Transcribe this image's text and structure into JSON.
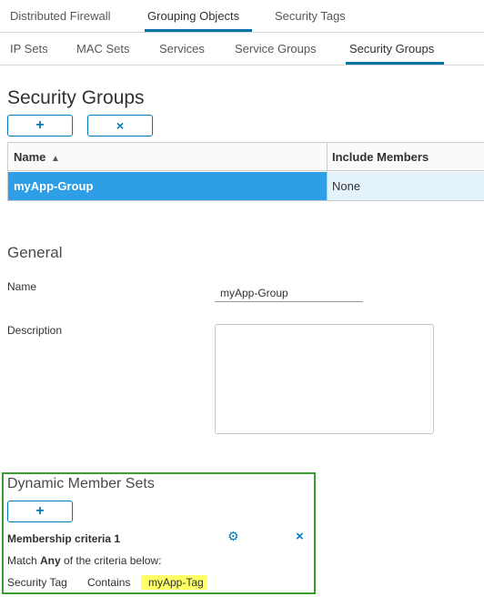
{
  "tabs_primary": [
    {
      "label": "Distributed Firewall"
    },
    {
      "label": "Grouping Objects",
      "active": true
    },
    {
      "label": "Security Tags"
    }
  ],
  "tabs_secondary": [
    {
      "label": "IP Sets"
    },
    {
      "label": "MAC Sets"
    },
    {
      "label": "Services"
    },
    {
      "label": "Service Groups"
    },
    {
      "label": "Security Groups",
      "active": true
    }
  ],
  "page_title": "Security Groups",
  "toolbar": {
    "add_label": "+",
    "delete_label": "×"
  },
  "grid": {
    "columns": [
      "Name",
      "Include Members"
    ],
    "sort_indicator": "▲",
    "rows": [
      {
        "name": "myApp-Group",
        "include_members": "None"
      }
    ]
  },
  "general": {
    "title": "General",
    "name_label": "Name",
    "name_value": "myApp-Group",
    "description_label": "Description",
    "description_value": ""
  },
  "dynamic_member_sets": {
    "title": "Dynamic Member Sets",
    "add_label": "+",
    "criteria_title": "Membership criteria 1",
    "match_prefix": "Match ",
    "match_value": "Any",
    "match_suffix": " of the criteria below:",
    "criterion": {
      "field": "Security Tag",
      "operator": "Contains",
      "value": "myApp-Tag"
    }
  },
  "colors": {
    "accent": "#0072a3",
    "selected_row": "#2e9fe6",
    "highlight_border": "#3c9c2f",
    "tag_highlight": "#ffff66"
  },
  "icons": [
    "gear-icon",
    "close-icon",
    "sort-ascending-icon",
    "plus-icon"
  ]
}
